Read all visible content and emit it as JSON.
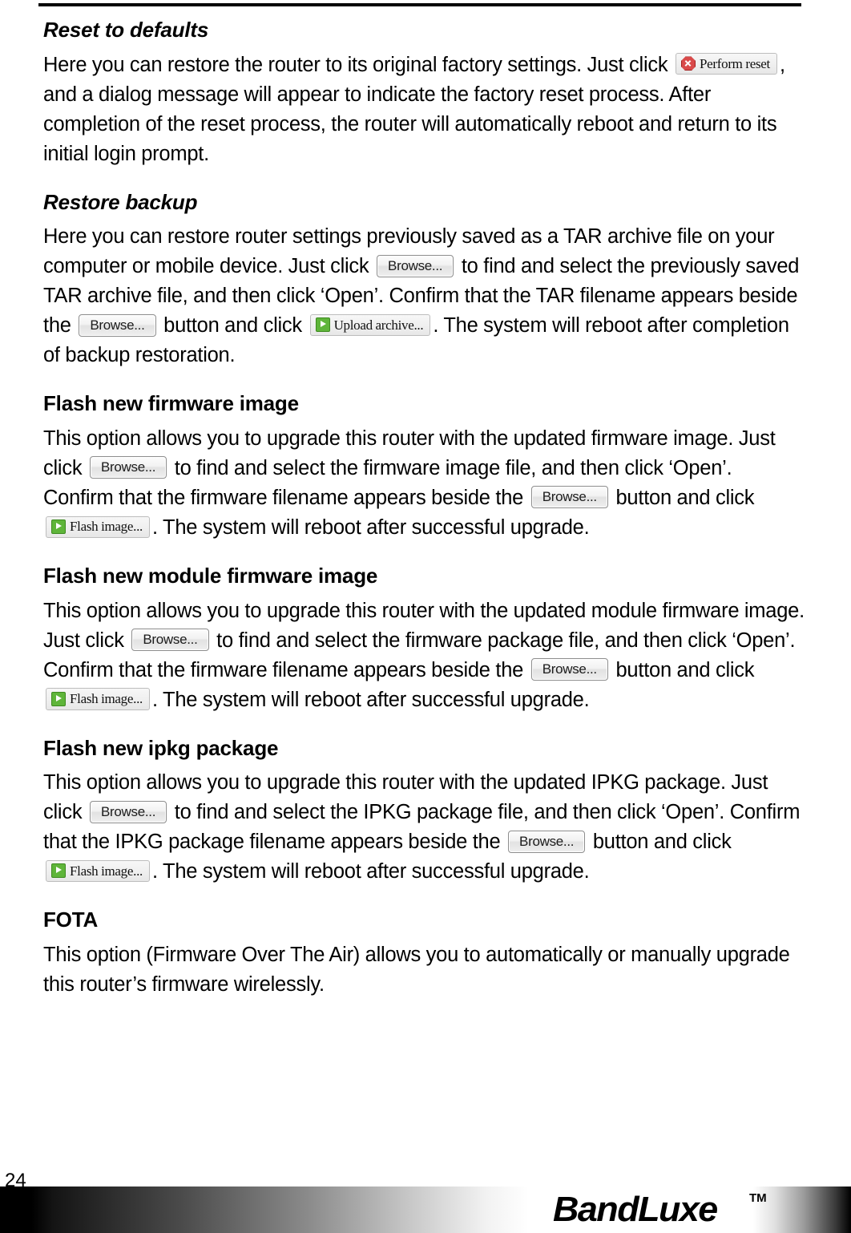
{
  "document": {
    "page_number": "24",
    "footer_brand": "BandLuxe",
    "footer_trademark": "TM"
  },
  "buttons": {
    "perform_reset": "Perform reset",
    "browse": "Browse...",
    "upload_archive": "Upload archive...",
    "flash_image": "Flash image..."
  },
  "icons": {
    "stop": "red-octagon-x-icon",
    "play": "green-play-icon"
  },
  "sections": [
    {
      "id": "reset-to-defaults",
      "title": "Reset to defaults",
      "title_style": "bold-italic",
      "paragraph": {
        "part1": "Here you can restore the router to its original factory settings. Just click ",
        "part2": ", and a dialog message will appear to indicate the factory reset process. After completion of the reset process, the router will automatically reboot and return to its initial login prompt."
      }
    },
    {
      "id": "restore-backup",
      "title": "Restore backup",
      "title_style": "bold-italic",
      "paragraph": {
        "part1": "Here you can restore router settings previously saved as a TAR archive file on your computer or mobile device. Just click ",
        "part2": " to find and select the previously saved TAR archive file, and then click ‘Open’. Confirm that the TAR filename appears beside the ",
        "part3": " button and click ",
        "part4": ". The system will reboot after completion of backup restoration."
      }
    },
    {
      "id": "flash-new-firmware-image",
      "title": "Flash new firmware image",
      "title_style": "bold",
      "paragraph": {
        "part1": "This option allows you to upgrade this router with the updated firmware image. Just click ",
        "part2": " to find and select the firmware image file, and then click ‘Open’. Confirm that the firmware filename appears beside the ",
        "part3": " button and click ",
        "part4": ". The system will reboot after successful upgrade."
      }
    },
    {
      "id": "flash-new-module-firmware-image",
      "title": "Flash new module firmware image",
      "title_style": "bold",
      "paragraph": {
        "part1": "This option allows you to upgrade this router with the updated module firmware image. Just click ",
        "part2": " to find and select the firmware package file, and then click ‘Open’. Confirm that the firmware filename appears beside the ",
        "part3": " button and click ",
        "part4": ". The system will reboot after successful upgrade."
      }
    },
    {
      "id": "flash-new-ipkg-package",
      "title": "Flash new ipkg package",
      "title_style": "bold",
      "paragraph": {
        "part1": "This option allows you to upgrade this router with the updated IPKG package. Just click ",
        "part2": " to find and select the IPKG package file, and then click ‘Open’. Confirm that the IPKG package filename appears beside the ",
        "part3": " button and click ",
        "part4": ". The system will reboot after successful upgrade."
      }
    },
    {
      "id": "fota",
      "title": "FOTA",
      "title_style": "bold",
      "paragraph": {
        "part1": "This option (Firmware Over The Air) allows you to automatically or manually upgrade this router’s firmware wirelessly."
      }
    }
  ]
}
